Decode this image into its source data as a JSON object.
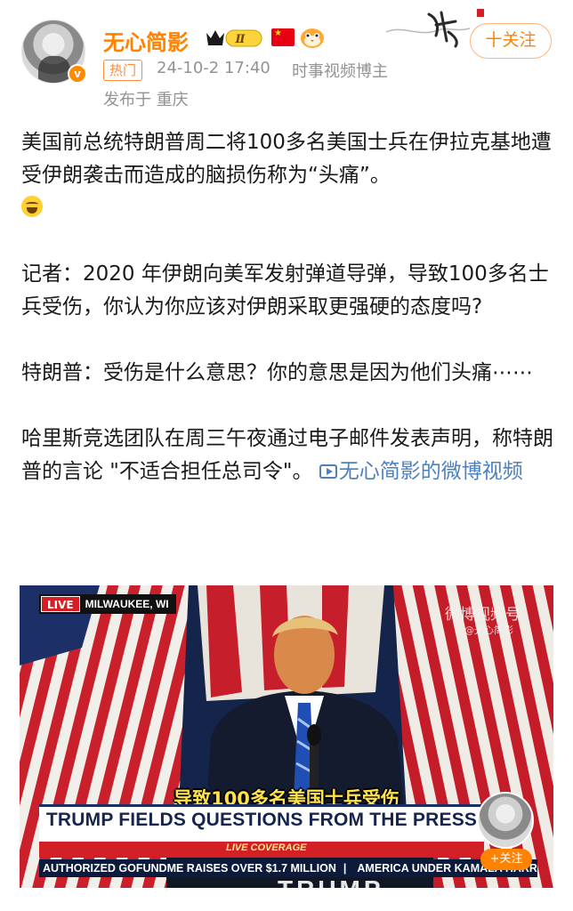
{
  "header": {
    "user_name": "无心简影",
    "crown_level": "Ⅱ",
    "hot_tag": "热门",
    "timestamp": "24-10-2 17:40",
    "category": "时事视频博主",
    "location": "发布于 重庆",
    "follow_label": "十关注",
    "verified_badge": "v",
    "icons": [
      "crown-level-icon",
      "china-flag-icon",
      "bird-badge-icon",
      "brush-calligraphy-decoration"
    ]
  },
  "post": {
    "paragraph_1": "美国前总统特朗普周二将100多名美国士兵在伊拉克基地遭受伊朗袭击而造成的脑损伤称为“头痛”。",
    "paragraph_2": "记者：2020 年伊朗向美军发射弹道导弹，导致100多名士兵受伤，你认为你应该对伊朗采取更强硬的态度吗?",
    "paragraph_3": "特朗普：受伤是什么意思？你的意思是因为他们头痛⋯⋯",
    "paragraph_4": "哈里斯竞选团队在周三午夜通过电子邮件发表声明，称特朗普的言论 \"不适合担任总司令\"。",
    "video_link": "无心简影的微博视频"
  },
  "video": {
    "live_tag": "LIVE",
    "live_location": "MILWAUKEE, WI",
    "watermark": "微博视频号",
    "watermark_sub": "@无心简影",
    "subtitle": "导致100多名美国士兵受伤",
    "chyron": "TRUMP FIELDS QUESTIONS FROM THE PRESS",
    "live_coverage": "LIVE COVERAGE",
    "ticker_1": "AUTHORIZED GOFUNDME RAISES OVER $1.7 MILLION",
    "ticker_2": "AMERICA UNDER KAMALA HARRIS IS A TH",
    "podium_text": "TRUMP",
    "mini_follow": "+关注"
  },
  "colors": {
    "accent_orange": "#ff8200",
    "link_blue": "#4d80bf",
    "meta_gray": "#939393",
    "chyron_navy": "#16254f",
    "live_red": "#d31f26"
  }
}
